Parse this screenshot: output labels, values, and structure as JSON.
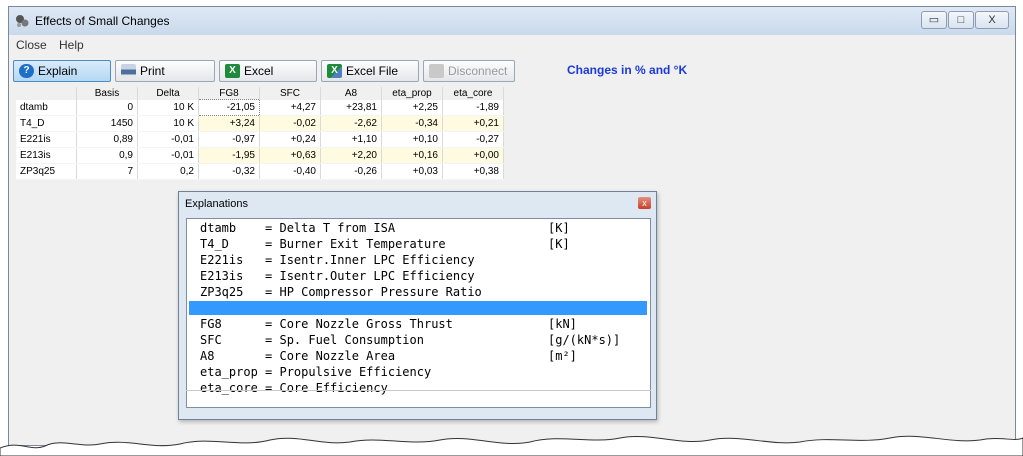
{
  "window": {
    "title": "Effects of Small Changes",
    "min_label": "▭",
    "max_label": "□",
    "close_label": "X"
  },
  "menu": {
    "items": [
      "Close",
      "Help"
    ]
  },
  "toolbar": {
    "buttons": [
      {
        "label": "Explain",
        "icon": "help-icon"
      },
      {
        "label": "Print",
        "icon": "printer-icon"
      },
      {
        "label": "Excel",
        "icon": "excel-icon"
      },
      {
        "label": "Excel File",
        "icon": "excel-file-icon"
      },
      {
        "label": "Disconnect",
        "icon": "disconnect-icon"
      }
    ],
    "changes_note": "Changes in % and °K"
  },
  "grid": {
    "columns": [
      "",
      "Basis",
      "Delta",
      "FG8",
      "SFC",
      "A8",
      "eta_prop",
      "eta_core"
    ],
    "rows": [
      {
        "name": "dtamb",
        "cells": [
          "0",
          "10 K",
          "-21,05",
          "+4,27",
          "+23,81",
          "+2,25",
          "-1,89"
        ]
      },
      {
        "name": "T4_D",
        "cells": [
          "1450",
          "10 K",
          "+3,24",
          "-0,02",
          "-2,62",
          "-0,34",
          "+0,21"
        ]
      },
      {
        "name": "E221is",
        "cells": [
          "0,89",
          "-0,01",
          "-0,97",
          "+0,24",
          "+1,10",
          "+0,10",
          "-0,27"
        ]
      },
      {
        "name": "E213is",
        "cells": [
          "0,9",
          "-0,01",
          "-1,95",
          "+0,63",
          "+2,20",
          "+0,16",
          "+0,00"
        ]
      },
      {
        "name": "ZP3q25",
        "cells": [
          "7",
          "0,2",
          "-0,32",
          "-0,40",
          "-0,26",
          "+0,03",
          "+0,38"
        ]
      }
    ]
  },
  "explanations": {
    "title": "Explanations",
    "inputs": [
      {
        "var": "dtamb   ",
        "desc": "= Delta T from ISA",
        "unit": "[K]"
      },
      {
        "var": "T4_D    ",
        "desc": "= Burner Exit Temperature",
        "unit": "[K]"
      },
      {
        "var": "E221is  ",
        "desc": "= Isentr.Inner LPC Efficiency",
        "unit": ""
      },
      {
        "var": "E213is  ",
        "desc": "= Isentr.Outer LPC Efficiency",
        "unit": ""
      },
      {
        "var": "ZP3q25  ",
        "desc": "= HP Compressor Pressure Ratio",
        "unit": ""
      }
    ],
    "outputs": [
      {
        "var": "FG8     ",
        "desc": "= Core Nozzle Gross Thrust",
        "unit": "[kN]"
      },
      {
        "var": "SFC     ",
        "desc": "= Sp. Fuel Consumption",
        "unit": "[g/(kN*s)]"
      },
      {
        "var": "A8      ",
        "desc": "= Core Nozzle Area",
        "unit": "[m²]"
      },
      {
        "var": "eta_prop",
        "desc": "= Propulsive Efficiency",
        "unit": ""
      },
      {
        "var": "eta_core",
        "desc": "= Core Efficiency",
        "unit": ""
      }
    ]
  }
}
